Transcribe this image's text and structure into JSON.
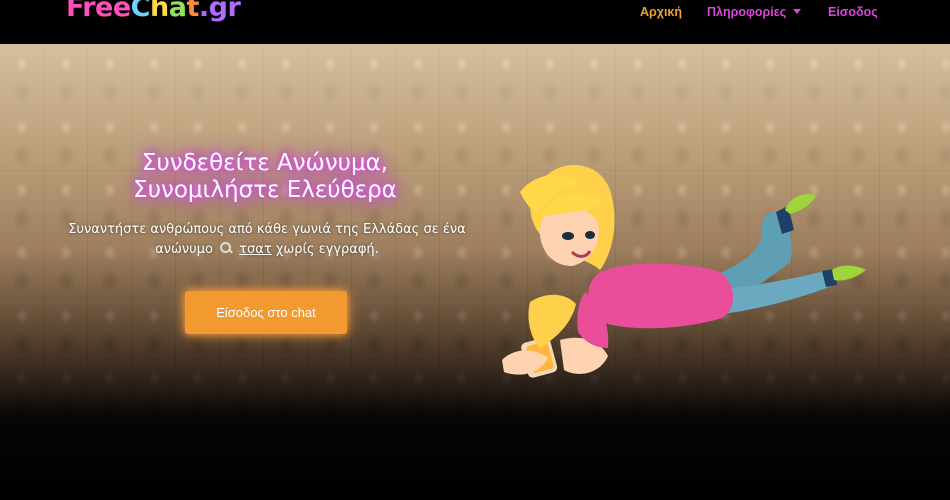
{
  "logo": {
    "text_parts": [
      "Free",
      "C",
      "h",
      "a",
      "t",
      ".gr"
    ]
  },
  "nav": {
    "home": "Αρχική",
    "info": "Πληροφορίες",
    "login": "Είσοδος"
  },
  "hero": {
    "title_line1": "Συνδεθείτε Ανώνυμα,",
    "title_line2": "Συνομιλήστε Ελεύθερα",
    "subtitle_part1": "Συναντήστε ανθρώπους από κάθε γωνιά της Ελλάδας σε ένα ανώνυμο",
    "subtitle_link": "τσατ",
    "subtitle_part2": "χωρίς εγγραφή.",
    "cta_label": "Είσοδος στο chat"
  },
  "colors": {
    "nav_home": "#f29f2b",
    "nav_accent": "#d946d9",
    "cta": "#f29a30",
    "title_glow": "#e040fb"
  }
}
